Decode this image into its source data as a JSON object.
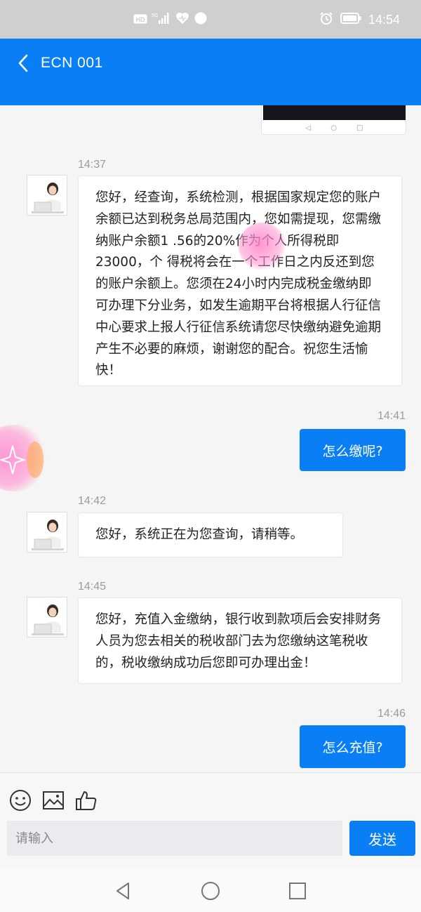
{
  "status_bar": {
    "network_badge": "HD",
    "signal_badge": "5G",
    "time": "14:54",
    "icons": [
      "hd-badge",
      "signal-5g-icon",
      "heart-app-icon",
      "compass-app-icon",
      "alarm-icon",
      "battery-icon"
    ]
  },
  "header": {
    "back_icon": "chevron-left-icon",
    "title": "ECN 001",
    "background": "#0a7ff5"
  },
  "chat": {
    "messages": [
      {
        "time": "14:37",
        "from": "agent",
        "text": "您好，经查询，系统检测，根据国家规定您的账户余额已达到税务总局范围内，您如需提现，您需缴纳账户余额1 .56的20%作为个人所得税即23000，个 得税将会在一个工作日之内反还到您的账户余额上。您须在24小时内完成税金缴纳即可办理下分业务，如发生逾期平台将根据人行征信中心要求上报人行征信系统请您尽快缴纳避免逾期产生不必要的麻烦，谢谢您的配合。祝您生活愉快！"
      },
      {
        "time": "14:41",
        "from": "user",
        "text": "怎么缴呢?"
      },
      {
        "time": "14:42",
        "from": "agent",
        "text": "您好，系统正在为您查询，请稍等。"
      },
      {
        "time": "14:45",
        "from": "agent",
        "text": "您好，充值入金缴纳，银行收到款项后会安排财务人员为您去相关的税收部门去为您缴纳这笔税收的，税收缴纳成功后您即可办理出金！"
      },
      {
        "time": "14:46",
        "from": "user",
        "text": "怎么充值?"
      }
    ]
  },
  "input": {
    "placeholder": "请输入",
    "send_label": "发送",
    "tools": [
      "emoji-icon",
      "image-icon",
      "thumbs-up-icon"
    ]
  },
  "nav": {
    "buttons": [
      "back-triangle-icon",
      "home-circle-icon",
      "recents-square-icon"
    ]
  },
  "colors": {
    "accent": "#0a7ff5",
    "bubble_in": "#ffffff",
    "bubble_out": "#0a7ff5",
    "timestamp": "#9b9b9b"
  }
}
